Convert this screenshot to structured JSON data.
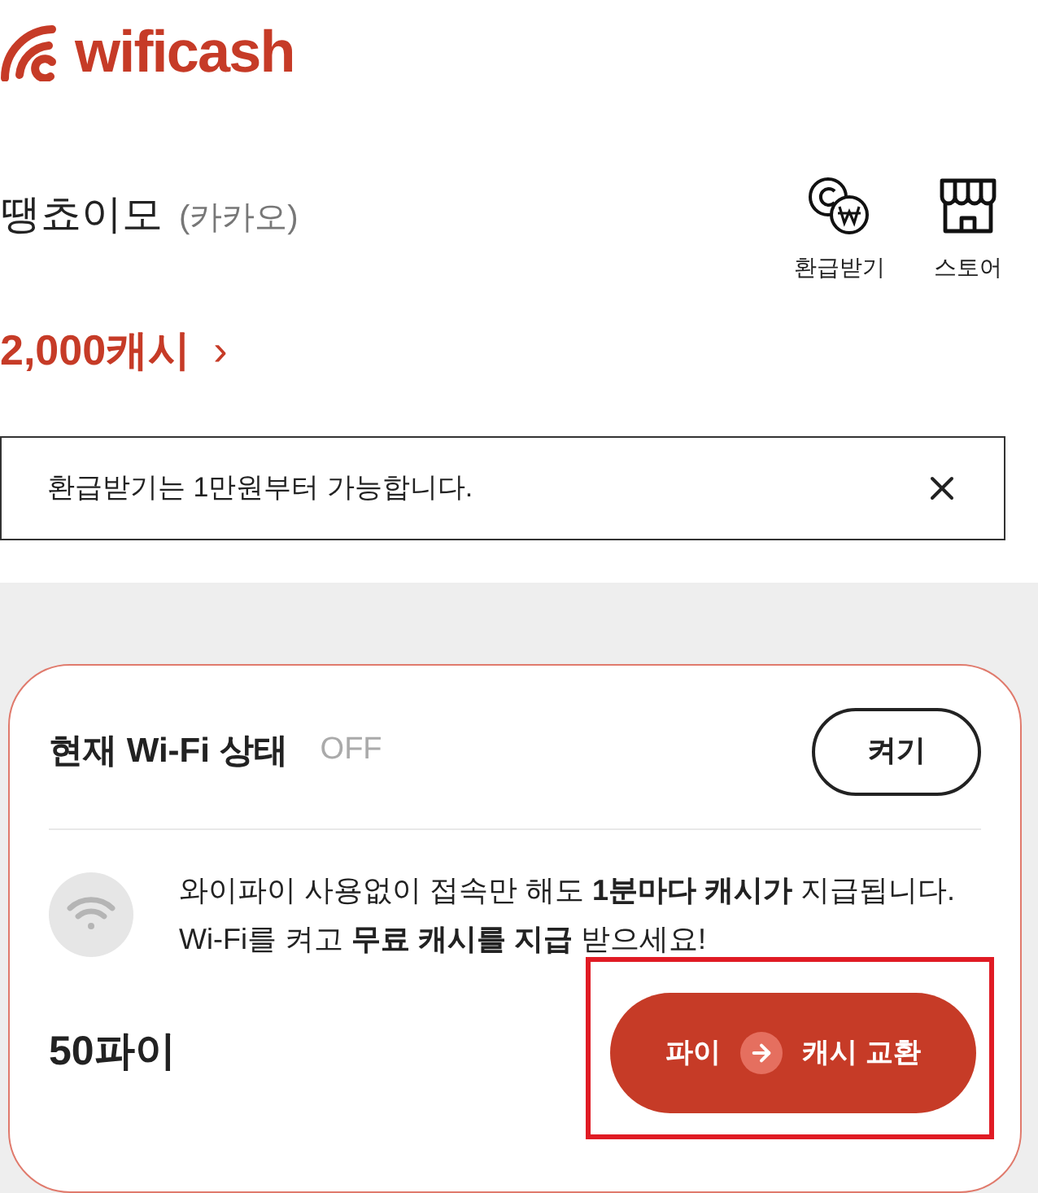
{
  "header": {
    "logo_text": "wificash"
  },
  "profile": {
    "name": "땡쵸이모",
    "provider": "(카카오)",
    "balance": "2,000캐시",
    "chevron": "›"
  },
  "actions": [
    {
      "kind": "refund",
      "label": "환급받기"
    },
    {
      "kind": "store",
      "label": "스토어"
    }
  ],
  "notice": {
    "text": "환급받기는 1만원부터 가능합니다."
  },
  "wifi_card": {
    "title": "현재 Wi-Fi 상태",
    "status": "OFF",
    "on": false,
    "toggle_label": "켜기",
    "message": "와이파이 사용없이 접속만 해도 **1분마다 캐시가** 지급됩니다. Wi-Fi를 켜고 **무료 캐시를 지급** 받으세요!",
    "points": "50파이",
    "exchange": {
      "from": "파이",
      "to": "캐시 교환",
      "highlighted": true
    }
  }
}
